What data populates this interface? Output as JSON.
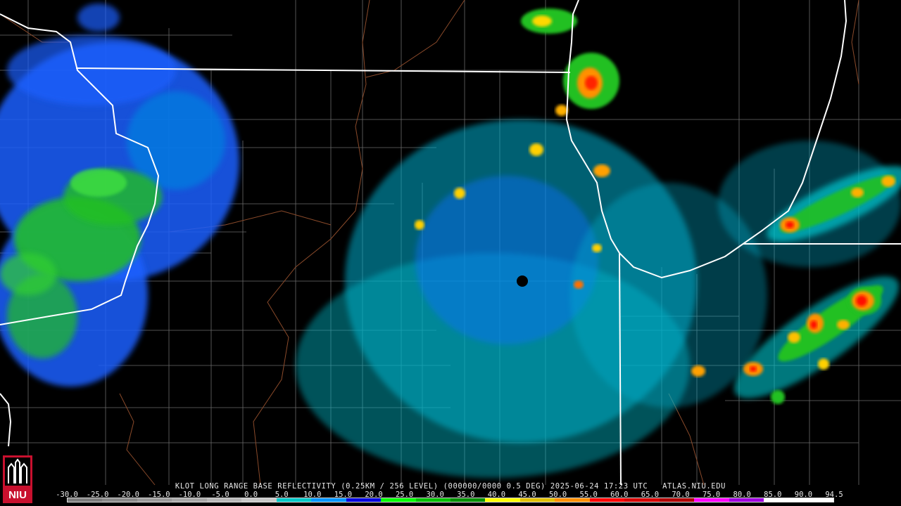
{
  "caption": {
    "product": "KLOT LONG RANGE BASE REFLECTIVITY (0.25KM / 256 LEVEL) (000000/0000 0.5 DEG)",
    "datetime": "2025-06-24 17:23 UTC",
    "source": "ATLAS.NIU.EDU"
  },
  "colorbar": {
    "ticks": [
      "-30.0",
      "-25.0",
      "-20.0",
      "-15.0",
      "-10.0",
      "-5.0",
      "0.0",
      "5.0",
      "10.0",
      "15.0",
      "20.0",
      "25.0",
      "30.0",
      "35.0",
      "40.0",
      "45.0",
      "50.0",
      "55.0",
      "60.0",
      "65.0",
      "70.0",
      "75.0",
      "80.0",
      "85.0",
      "90.0",
      "94.5"
    ],
    "colors": [
      "#7d7d7d",
      "#8a8a8a",
      "#9a9a9a",
      "#a8a8a8",
      "#b8b8b8",
      "#c8c8c8",
      "#00c8c8",
      "#0096ff",
      "#0000e0",
      "#00ff00",
      "#00c000",
      "#009000",
      "#ffff00",
      "#e0c000",
      "#ff9000",
      "#ff0000",
      "#d80000",
      "#b00000",
      "#ff00ff",
      "#a000e0",
      "#ffffff",
      "#ffffff"
    ]
  },
  "logo": {
    "text": "NIU"
  },
  "colors": {
    "state_border": "#ffffff",
    "county_border": "#707070",
    "river": "#8a4a2a",
    "background": "#000000"
  }
}
